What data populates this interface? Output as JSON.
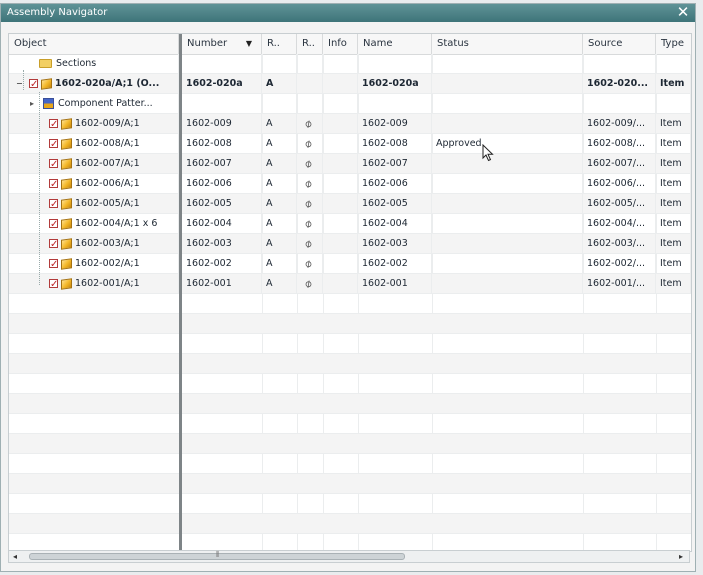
{
  "window": {
    "title": "Assembly Navigator",
    "close_symbol": "✕"
  },
  "columns": [
    {
      "label": "Object"
    },
    {
      "label": "Number",
      "sort_symbol": "▼"
    },
    {
      "label": "R.."
    },
    {
      "label": "R.."
    },
    {
      "label": "Info"
    },
    {
      "label": "Name"
    },
    {
      "label": "Status"
    },
    {
      "label": "Source"
    },
    {
      "label": "Type"
    }
  ],
  "rows": [
    {
      "object": "Sections",
      "icon": "folder-icon",
      "number": "",
      "r1": "",
      "r2": "",
      "info": "",
      "name": "",
      "status": "",
      "source": "",
      "type": ""
    },
    {
      "object": "1602-020a/A;1 (O...",
      "icon": "assembly-icon",
      "expander": "−",
      "number": "1602-020a",
      "r1": "A",
      "r2": "",
      "info": "",
      "name": "1602-020a",
      "status": "",
      "source": "1602-020...",
      "type": "Item"
    },
    {
      "object": "Component Patter...",
      "icon": "component-pattern-icon",
      "expander": "▸",
      "number": "",
      "r1": "",
      "r2": "",
      "info": "",
      "name": "",
      "status": "",
      "source": "",
      "type": ""
    },
    {
      "object": "1602-009/A;1",
      "icon": "part-icon",
      "number": "1602-009",
      "r1": "A",
      "r2": "attachment",
      "info": "",
      "name": "1602-009",
      "status": "",
      "source": "1602-009/...",
      "type": "Item"
    },
    {
      "object": "1602-008/A;1",
      "icon": "part-icon",
      "number": "1602-008",
      "r1": "A",
      "r2": "attachment",
      "info": "",
      "name": "1602-008",
      "status": "Approved",
      "source": "1602-008/...",
      "type": "Item"
    },
    {
      "object": "1602-007/A;1",
      "icon": "part-icon",
      "number": "1602-007",
      "r1": "A",
      "r2": "attachment",
      "info": "",
      "name": "1602-007",
      "status": "",
      "source": "1602-007/...",
      "type": "Item"
    },
    {
      "object": "1602-006/A;1",
      "icon": "part-icon",
      "number": "1602-006",
      "r1": "A",
      "r2": "attachment",
      "info": "",
      "name": "1602-006",
      "status": "",
      "source": "1602-006/...",
      "type": "Item"
    },
    {
      "object": "1602-005/A;1",
      "icon": "part-icon",
      "number": "1602-005",
      "r1": "A",
      "r2": "attachment",
      "info": "",
      "name": "1602-005",
      "status": "",
      "source": "1602-005/...",
      "type": "Item"
    },
    {
      "object": "1602-004/A;1 x 6",
      "icon": "part-icon",
      "number": "1602-004",
      "r1": "A",
      "r2": "attachment",
      "info": "",
      "name": "1602-004",
      "status": "",
      "source": "1602-004/...",
      "type": "Item"
    },
    {
      "object": "1602-003/A;1",
      "icon": "part-icon",
      "number": "1602-003",
      "r1": "A",
      "r2": "attachment",
      "info": "",
      "name": "1602-003",
      "status": "",
      "source": "1602-003/...",
      "type": "Item"
    },
    {
      "object": "1602-002/A;1",
      "icon": "part-icon",
      "number": "1602-002",
      "r1": "A",
      "r2": "attachment",
      "info": "",
      "name": "1602-002",
      "status": "",
      "source": "1602-002/...",
      "type": "Item"
    },
    {
      "object": "1602-001/A;1",
      "icon": "part-icon",
      "number": "1602-001",
      "r1": "A",
      "r2": "attachment",
      "info": "",
      "name": "1602-001",
      "status": "",
      "source": "1602-001/...",
      "type": "Item"
    }
  ],
  "scrollbar": {
    "left_arrow": "◂",
    "right_arrow": "▸",
    "grip": "⦀"
  },
  "colors": {
    "titlebar": "#4a8185",
    "splitter": "#7e8487",
    "checkbox": "#c0262a",
    "part": "#f2b526"
  }
}
